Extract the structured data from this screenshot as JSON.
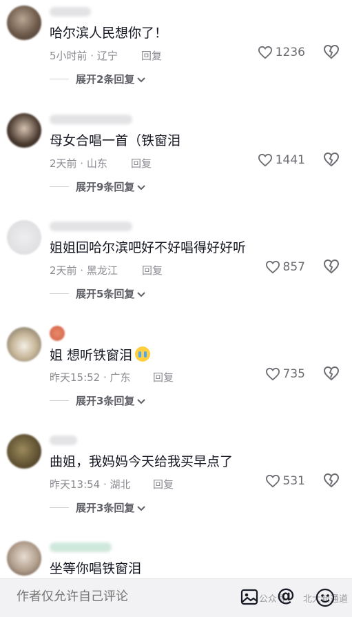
{
  "comments": [
    {
      "text": "哈尔滨人民想你了！",
      "time": "5小时前 · 辽宁",
      "reply": "回复",
      "likes": "1236",
      "expand": "展开2条回复"
    },
    {
      "text": "母女合唱一首（铁窗泪",
      "time": "2天前 · 山东",
      "reply": "回复",
      "likes": "1441",
      "expand": "展开9条回复"
    },
    {
      "text": "姐姐回哈尔滨吧好不好唱得好好听",
      "time": "2天前 · 黑龙江",
      "reply": "回复",
      "likes": "857",
      "expand": "展开5条回复"
    },
    {
      "text": "姐 想听铁窗泪",
      "time": "昨天15:52 · 广东",
      "reply": "回复",
      "likes": "735",
      "expand": "展开3条回复"
    },
    {
      "text": "曲姐，我妈妈今天给我买早点了",
      "time": "昨天13:54 · 湖北",
      "reply": "回复",
      "likes": "531",
      "expand": "展开3条回复"
    },
    {
      "text": "坐等你唱铁窗泪"
    }
  ],
  "bottom": {
    "placeholder": "作者仅允许自己评论",
    "watermark_left": "公众号",
    "watermark_right": "北大新通道"
  },
  "icons": {
    "like": "heart-icon",
    "dislike": "broken-heart-icon",
    "chevron": "chevron-down-icon",
    "image": "image-icon",
    "mention": "at-icon",
    "emoji": "emoji-icon",
    "cry": "crying-emoji-icon"
  },
  "colors": {
    "text": "#161823",
    "meta": "#8a8b91",
    "bar": "#f2f2f4"
  }
}
